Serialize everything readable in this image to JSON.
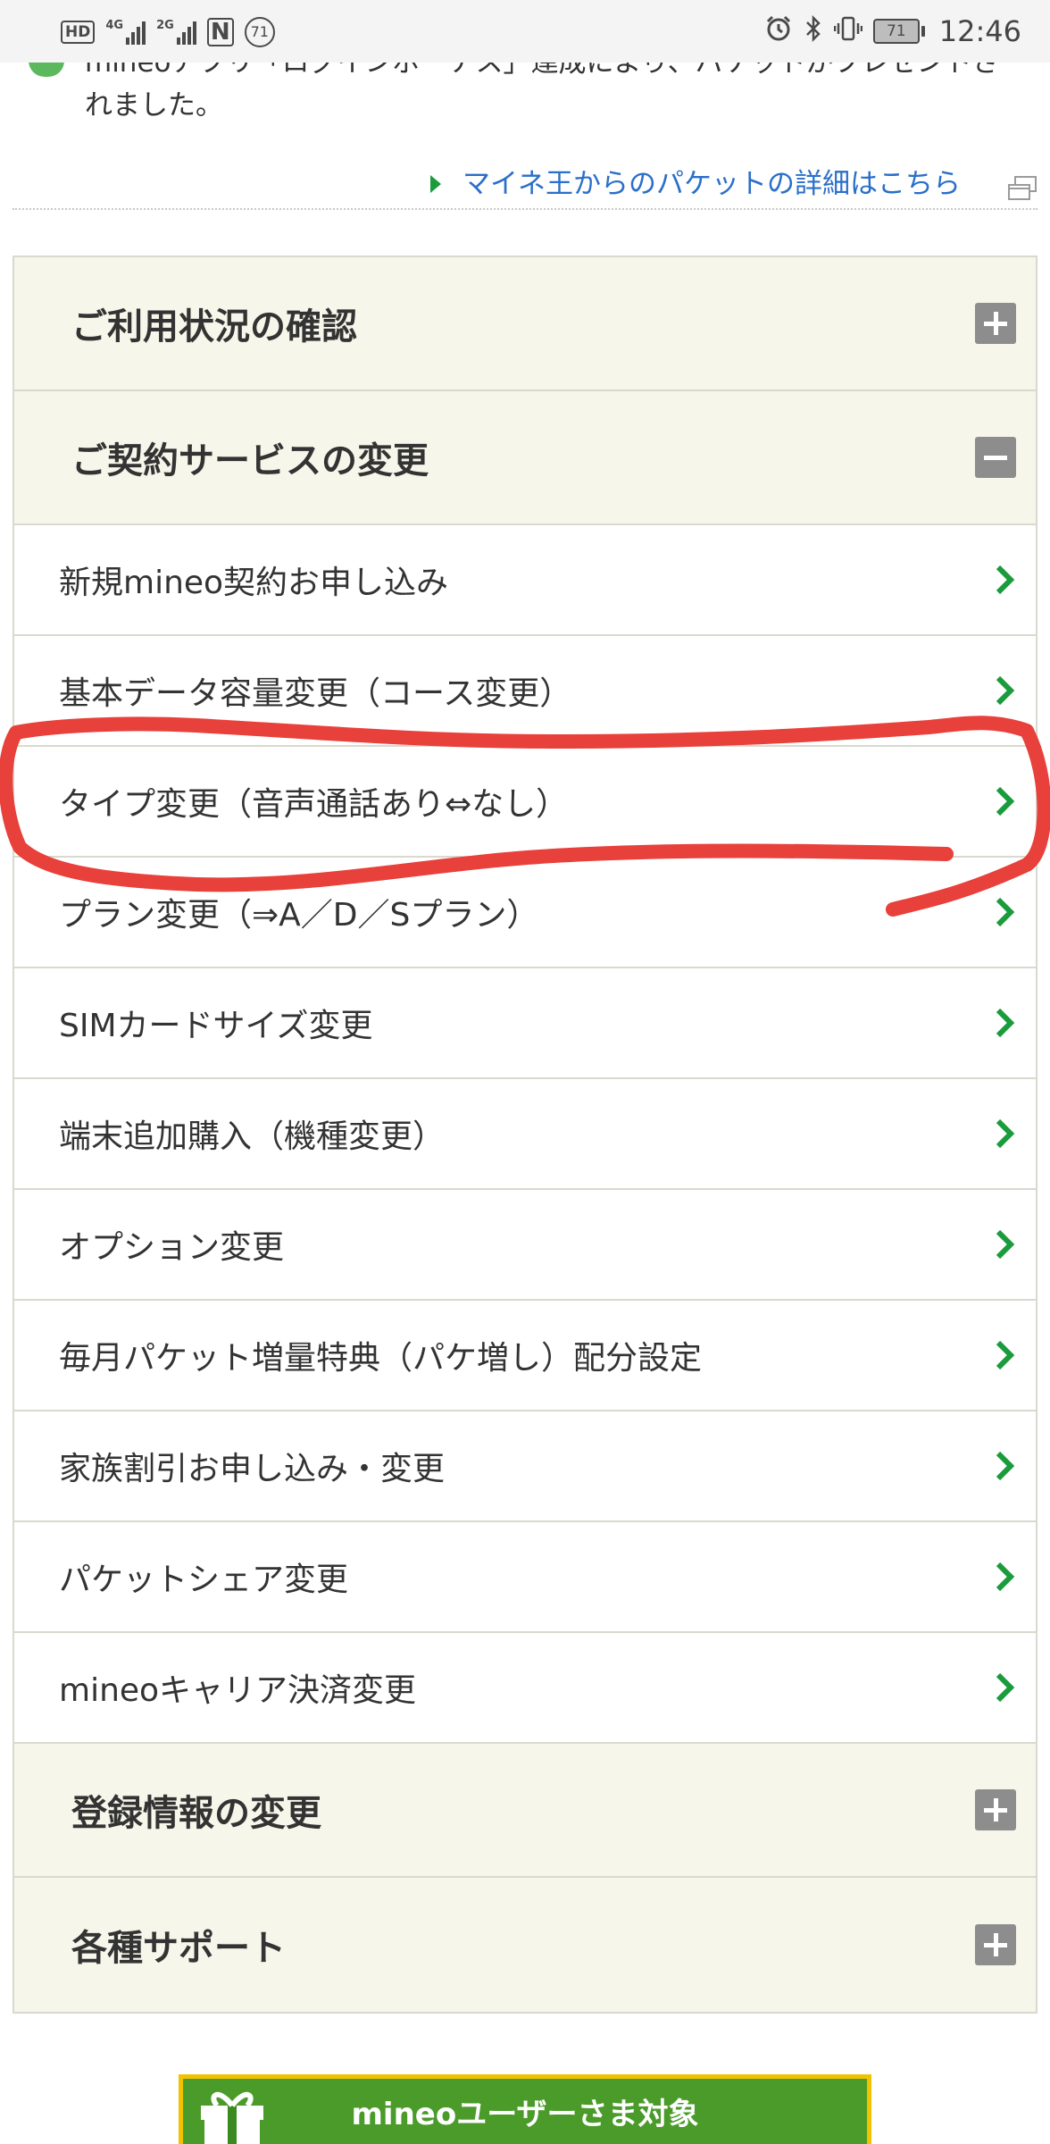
{
  "status_bar": {
    "hd_label": "HD",
    "net1_label": "4G",
    "net2_label": "2G",
    "nfc_label": "N",
    "notification_count": "71",
    "battery_level": "71",
    "time": "12:46"
  },
  "notice": {
    "line1_partial": "mineoアプリ「ログインボーナス」達成により、パケットがプレゼントさ",
    "line2": "れました。"
  },
  "packet_link": {
    "label": "マイネ王からのパケットの詳細はこちら"
  },
  "menu": {
    "usage": {
      "title": "ご利用状況の確認"
    },
    "contract": {
      "title": "ご契約サービスの変更",
      "items": [
        {
          "label": "新規mineo契約お申し込み"
        },
        {
          "label": "基本データ容量変更（コース変更）"
        },
        {
          "label": "タイプ変更（音声通話あり⇔なし）"
        },
        {
          "label": "プラン変更（⇒A／D／Sプラン）"
        },
        {
          "label": "SIMカードサイズ変更"
        },
        {
          "label": "端末追加購入（機種変更）"
        },
        {
          "label": "オプション変更"
        },
        {
          "label": "毎月パケット増量特典（パケ増し）配分設定"
        },
        {
          "label": "家族割引お申し込み・変更"
        },
        {
          "label": "パケットシェア変更"
        },
        {
          "label": "mineoキャリア決済変更"
        }
      ]
    },
    "registration": {
      "title": "登録情報の変更"
    },
    "support": {
      "title": "各種サポート"
    }
  },
  "banner": {
    "label": "mineoユーザーさま対象"
  },
  "colors": {
    "section_bg": "#f7f6ea",
    "border": "#d9d9cf",
    "chevron": "#1a9b3c",
    "link": "#2a6fc9",
    "annotation": "#e8403a",
    "toggle": "#8d8d8d"
  }
}
